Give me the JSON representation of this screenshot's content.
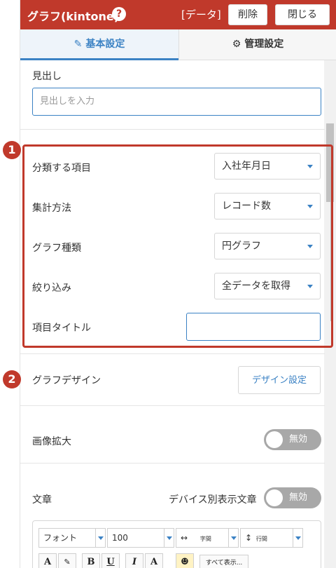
{
  "header": {
    "title": "グラフ(kintone)",
    "help_icon": "?",
    "tag": "[データ]",
    "delete_label": "削除",
    "close_label": "閉じる",
    "bg_color": "#c0392b"
  },
  "tabs": [
    {
      "label": "基本設定",
      "icon": "edit-icon",
      "active": true
    },
    {
      "label": "管理設定",
      "icon": "gear-icon",
      "active": false
    }
  ],
  "heading_section": {
    "label": "見出し",
    "placeholder": "見出しを入力"
  },
  "badges": [
    "1",
    "2"
  ],
  "fields": {
    "category": {
      "label": "分類する項目",
      "value": "入社年月日"
    },
    "aggregation": {
      "label": "集計方法",
      "value": "レコード数"
    },
    "chart_type": {
      "label": "グラフ種類",
      "value": "円グラフ"
    },
    "filter": {
      "label": "絞り込み",
      "value": "全データを取得"
    },
    "item_title": {
      "label": "項目タイトル",
      "value": ""
    }
  },
  "design": {
    "label": "グラフデザイン",
    "button": "デザイン設定"
  },
  "image_zoom": {
    "label": "画像拡大",
    "toggle": "無効"
  },
  "text": {
    "label": "文章",
    "device_label": "デバイス別表示文章",
    "toggle": "無効"
  },
  "editor": {
    "font_label": "フォント",
    "size_value": "100",
    "spacing_icon": "↔",
    "spacing_label": "字間",
    "line_icon": "↕",
    "line_label": "行間",
    "buttons": [
      "A",
      "✎",
      "B",
      "U",
      "I",
      "A",
      "☻"
    ],
    "show_all": "すべて表示..."
  }
}
